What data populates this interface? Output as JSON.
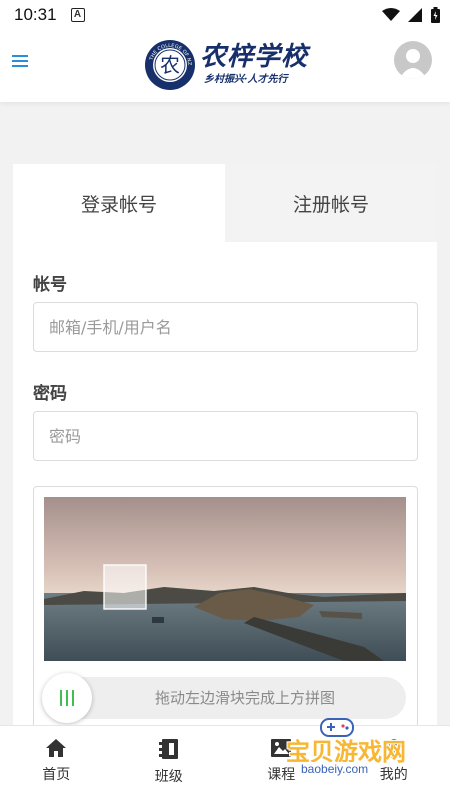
{
  "status_bar": {
    "time": "10:31",
    "notification_icon": "a-icon",
    "icons": [
      "wifi-icon",
      "signal-icon",
      "battery-icon"
    ]
  },
  "header": {
    "menu_icon": "hamburger-menu-icon",
    "logo": {
      "title": "农梓学校",
      "slogan": "乡村振兴·人才先行",
      "seal_text": "农",
      "seal_ring_text": "THE COLLEGE OF NZ"
    },
    "avatar_icon": "user-avatar-icon"
  },
  "login": {
    "tabs": [
      {
        "label": "登录帐号",
        "active": true
      },
      {
        "label": "注册帐号",
        "active": false
      }
    ],
    "account": {
      "label": "帐号",
      "placeholder": "邮箱/手机/用户名",
      "value": ""
    },
    "password": {
      "label": "密码",
      "placeholder": "密码",
      "value": ""
    },
    "captcha": {
      "slider_text": "拖动左边滑块完成上方拼图",
      "handle_icon": "drag-handle-icon",
      "progress": 0
    }
  },
  "bottom_nav": [
    {
      "label": "首页",
      "icon": "home-icon"
    },
    {
      "label": "班级",
      "icon": "class-icon"
    },
    {
      "label": "课程",
      "icon": "course-icon"
    },
    {
      "label": "我的",
      "icon": "profile-icon"
    }
  ],
  "watermark": {
    "text": "宝贝游戏网",
    "url": "baobeiy.com"
  },
  "colors": {
    "accent": "#2a8fd9",
    "brand_navy": "#17306b",
    "slider_grip": "#3fbf4f",
    "watermark": "#f7b733"
  }
}
